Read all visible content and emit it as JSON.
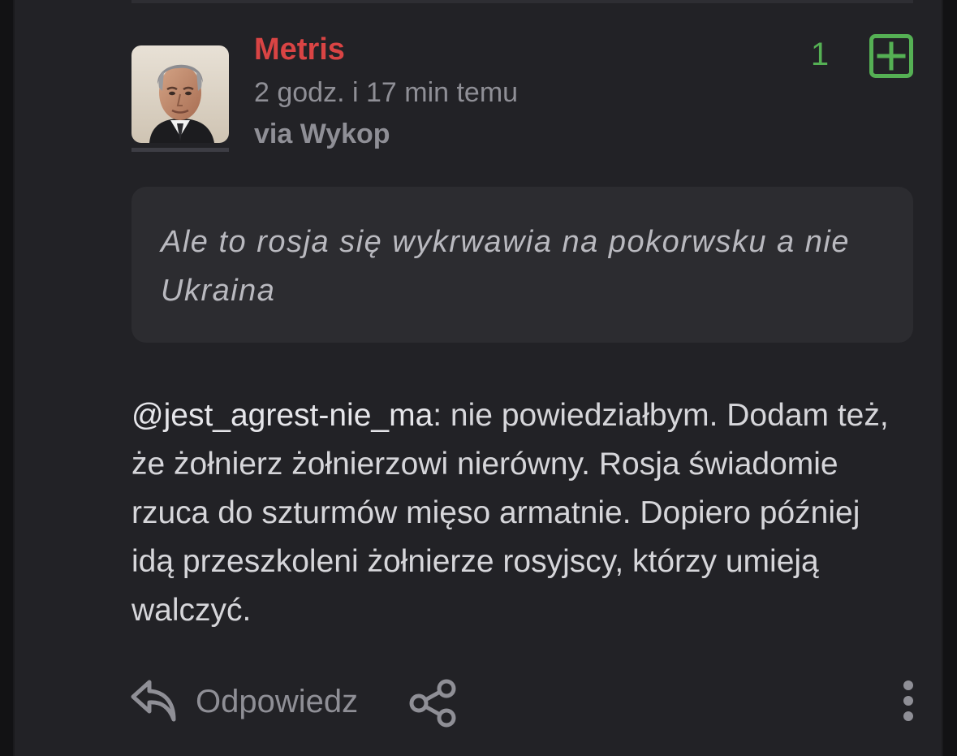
{
  "comment": {
    "author": "Metris",
    "timestamp": "2 godz. i 17 min temu",
    "via_prefix": "via",
    "via_source": "Wykop",
    "vote_count": "1",
    "quote": "Ale to rosja się wykrwawia na pokorwsku a nie Ukraina",
    "mention": "@jest_agrest-nie_ma",
    "body": ": nie powiedziałbym. Dodam też, że żołnierz żołnierzowi nierówny. Rosja świadomie rzuca do szturmów mięso armatnie. Dopiero później idą przeszkoleni żołnierze rosyjscy, którzy umieją walczyć."
  },
  "actions": {
    "reply_label": "Odpowiedz"
  },
  "icons": {
    "vote": "plus-square-icon",
    "reply": "reply-arrow-icon",
    "share": "share-icon",
    "more": "more-vertical-icon"
  },
  "colors": {
    "author": "#d94444",
    "vote": "#55b054",
    "muted": "#8f8f96",
    "background": "#222226",
    "quote_background": "#2c2c30"
  }
}
